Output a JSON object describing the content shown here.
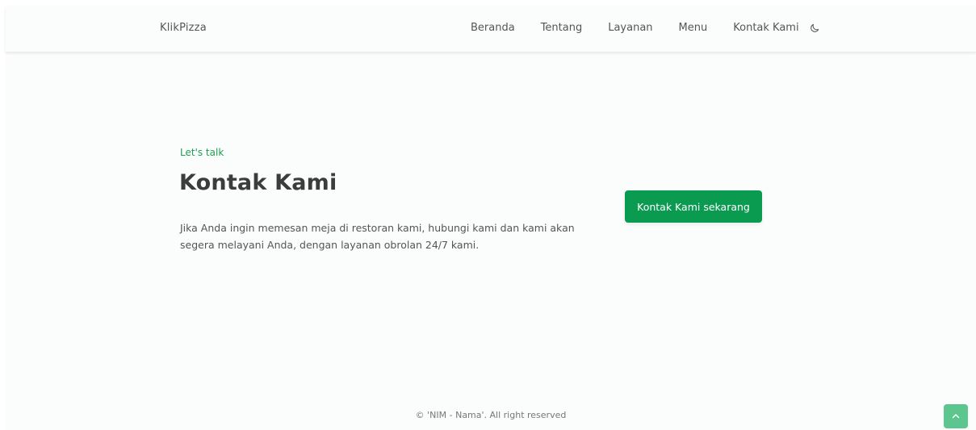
{
  "header": {
    "brand": "KlikPizza",
    "nav": [
      {
        "label": "Beranda"
      },
      {
        "label": "Tentang"
      },
      {
        "label": "Layanan"
      },
      {
        "label": "Menu"
      },
      {
        "label": "Kontak Kami"
      }
    ],
    "theme_toggle_icon": "moon-icon"
  },
  "hero": {
    "tagline": "Let's talk",
    "title": "Kontak Kami",
    "description": "Jika Anda ingin memesan meja di restoran kami, hubungi kami dan kami akan segera melayani Anda, dengan layanan obrolan 24/7 kami.",
    "cta_label": "Kontak Kami sekarang"
  },
  "footer": {
    "copyright": "© 'NIM - Nama'. All right reserved"
  },
  "back_to_top_icon": "chevron-up-icon",
  "colors": {
    "accent": "#0a9a50",
    "tagline": "#1e9e52",
    "back_to_top": "#5cc68e",
    "background": "#fbfcfc"
  }
}
